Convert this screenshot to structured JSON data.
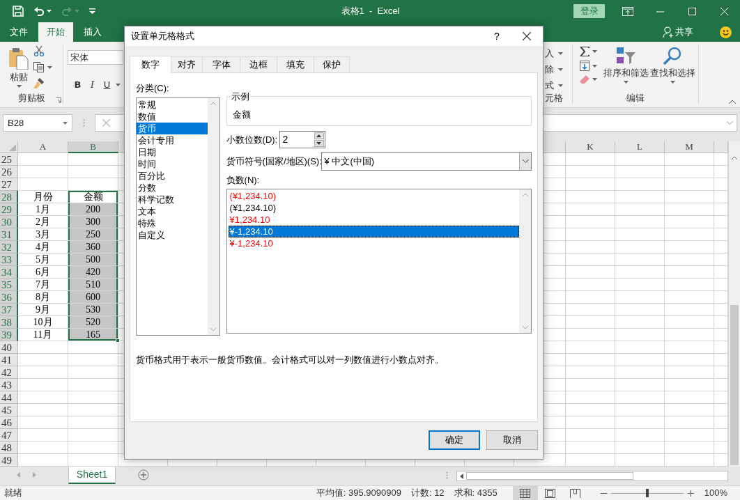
{
  "title_bar": {
    "quick_access": [
      {
        "kind": "save",
        "disabled": false
      },
      {
        "kind": "undo",
        "disabled": false
      },
      {
        "kind": "redo",
        "disabled": true
      },
      {
        "kind": "customize",
        "disabled": false
      }
    ],
    "title": "表格1  -  Excel",
    "sign_in": "登录"
  },
  "ribbon_tabs": [
    {
      "label": "文件",
      "selected": false
    },
    {
      "label": "开始",
      "selected": true
    },
    {
      "label": "插入",
      "selected": false
    }
  ],
  "share": "共享",
  "ribbon": {
    "clipboard": {
      "paste": "粘贴",
      "label": "剪贴板"
    },
    "font": {
      "name": "宋体",
      "bold": "B",
      "italic": "I",
      "underline": "U"
    },
    "cells": {
      "items": [
        "入",
        "除",
        "式"
      ],
      "label": "元格"
    },
    "editing": {
      "sort": "排序和筛选",
      "find": "查找和选择",
      "label": "编辑"
    }
  },
  "formula_bar": {
    "name_box": "B28"
  },
  "sheet": {
    "columns": [
      {
        "label": "A",
        "selected": false
      },
      {
        "label": "B",
        "selected": true
      },
      {
        "label": "K",
        "selected": false
      },
      {
        "label": "L",
        "selected": false
      },
      {
        "label": "M",
        "selected": false
      }
    ],
    "rows": [
      {
        "label": "25",
        "selected": false
      },
      {
        "label": "26",
        "selected": false
      },
      {
        "label": "27",
        "selected": false
      },
      {
        "label": "28",
        "selected": true,
        "cells": [
          "月份",
          "金额"
        ]
      },
      {
        "label": "29",
        "selected": true,
        "cells": [
          "1月",
          "200"
        ]
      },
      {
        "label": "30",
        "selected": true,
        "cells": [
          "2月",
          "300"
        ]
      },
      {
        "label": "31",
        "selected": true,
        "cells": [
          "3月",
          "250"
        ]
      },
      {
        "label": "32",
        "selected": true,
        "cells": [
          "4月",
          "360"
        ]
      },
      {
        "label": "33",
        "selected": true,
        "cells": [
          "5月",
          "500"
        ]
      },
      {
        "label": "34",
        "selected": true,
        "cells": [
          "6月",
          "420"
        ]
      },
      {
        "label": "35",
        "selected": true,
        "cells": [
          "7月",
          "510"
        ]
      },
      {
        "label": "36",
        "selected": true,
        "cells": [
          "8月",
          "600"
        ]
      },
      {
        "label": "37",
        "selected": true,
        "cells": [
          "9月",
          "530"
        ]
      },
      {
        "label": "38",
        "selected": true,
        "cells": [
          "10月",
          "520"
        ]
      },
      {
        "label": "39",
        "selected": true,
        "cells": [
          "11月",
          "165"
        ]
      },
      {
        "label": "40",
        "selected": false
      },
      {
        "label": "41",
        "selected": false
      },
      {
        "label": "42",
        "selected": false
      },
      {
        "label": "43",
        "selected": false
      },
      {
        "label": "44",
        "selected": false
      },
      {
        "label": "45",
        "selected": false
      },
      {
        "label": "46",
        "selected": false
      },
      {
        "label": "47",
        "selected": false
      },
      {
        "label": "48",
        "selected": false
      },
      {
        "label": "49",
        "selected": false
      }
    ]
  },
  "sheet_tabs": [
    {
      "label": "Sheet1",
      "selected": true
    }
  ],
  "status_bar": {
    "state": "就绪",
    "average": "平均值: 395.9090909",
    "count": "计数: 12",
    "sum": "求和: 4355",
    "views": [
      {
        "kind": "normal",
        "selected": true
      },
      {
        "kind": "page_layout",
        "selected": false
      },
      {
        "kind": "page_break",
        "selected": false
      }
    ],
    "zoom": {
      "level": 0.5,
      "reading": "100%"
    }
  },
  "dialog": {
    "title": "设置单元格格式",
    "help": "?",
    "tabs": [
      {
        "label": "数字",
        "selected": true
      },
      {
        "label": "对齐",
        "selected": false
      },
      {
        "label": "字体",
        "selected": false
      },
      {
        "label": "边框",
        "selected": false
      },
      {
        "label": "填充",
        "selected": false
      },
      {
        "label": "保护",
        "selected": false
      }
    ],
    "category_label": "分类(C):",
    "categories": [
      {
        "label": "常规",
        "selected": false
      },
      {
        "label": "数值",
        "selected": false
      },
      {
        "label": "货币",
        "selected": true
      },
      {
        "label": "会计专用",
        "selected": false
      },
      {
        "label": "日期",
        "selected": false
      },
      {
        "label": "时间",
        "selected": false
      },
      {
        "label": "百分比",
        "selected": false
      },
      {
        "label": "分数",
        "selected": false
      },
      {
        "label": "科学记数",
        "selected": false
      },
      {
        "label": "文本",
        "selected": false
      },
      {
        "label": "特殊",
        "selected": false
      },
      {
        "label": "自定义",
        "selected": false
      }
    ],
    "sample": {
      "legend": "示例",
      "value": "金额"
    },
    "decimal_places": {
      "label": "小数位数(D):",
      "value": "2"
    },
    "currency_symbol": {
      "label": "货币符号(国家/地区)(S):",
      "value": "¥ 中文(中国)"
    },
    "negative_label": "负数(N):",
    "negative_numbers": [
      {
        "text": "(¥1,234.10)",
        "color": "#ff0000",
        "selected": false
      },
      {
        "text": "(¥1,234.10)",
        "color": "#000000",
        "selected": false
      },
      {
        "text": "¥1,234.10",
        "color": "#ff0000",
        "selected": false
      },
      {
        "text": "¥-1,234.10",
        "selected": true
      },
      {
        "text": "¥-1,234.10",
        "color": "#ff0000",
        "selected": false
      }
    ],
    "description": "货币格式用于表示一般货币数值。会计格式可以对一列数值进行小数点对齐。",
    "buttons": [
      {
        "label": "确定",
        "kind": "default"
      },
      {
        "label": "取消",
        "kind": "normal"
      }
    ]
  }
}
